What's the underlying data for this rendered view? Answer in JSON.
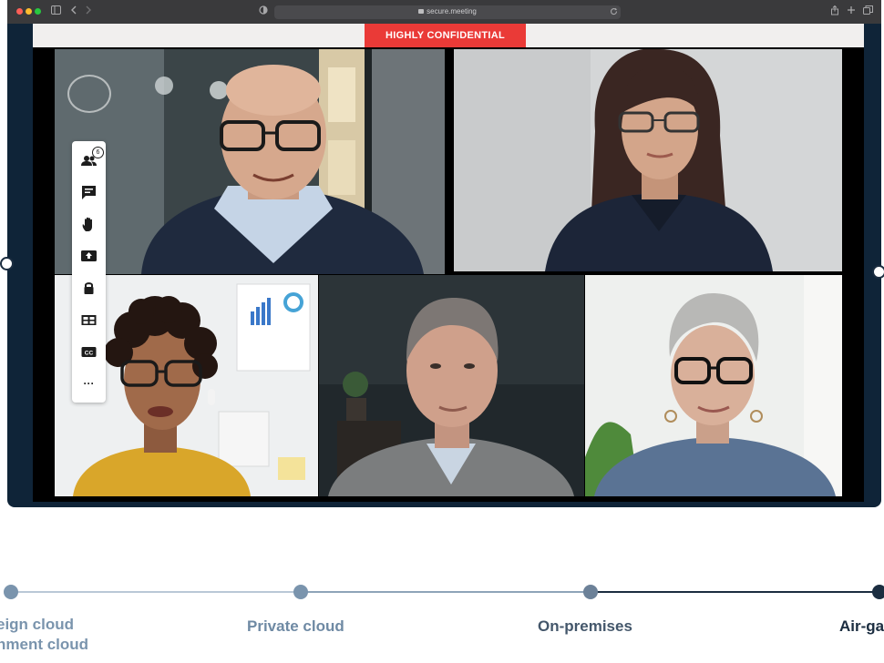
{
  "browser": {
    "url": "secure.meeting",
    "toolbar_icons": [
      "sidebar-icon",
      "back-icon",
      "forward-icon",
      "privacy-icon",
      "reload-icon",
      "share-icon",
      "new-tab-icon",
      "tabs-icon"
    ]
  },
  "meeting": {
    "banner": "HIGHLY CONFIDENTIAL",
    "participant_count": "6",
    "toolbar": [
      "participants-icon",
      "chat-icon",
      "raise-hand-icon",
      "share-screen-icon",
      "lock-icon",
      "layout-icon",
      "captions-icon",
      "more-icon"
    ],
    "captions_label": "CC",
    "more_label": "···"
  },
  "timeline": {
    "labels": [
      "eign cloud",
      "nment cloud",
      "Private cloud",
      "On-premises",
      "Air-ga"
    ],
    "colors": {
      "inactive": "#7a94ad",
      "active": "#1b2d40",
      "line_light": "#b9c8d6"
    }
  }
}
